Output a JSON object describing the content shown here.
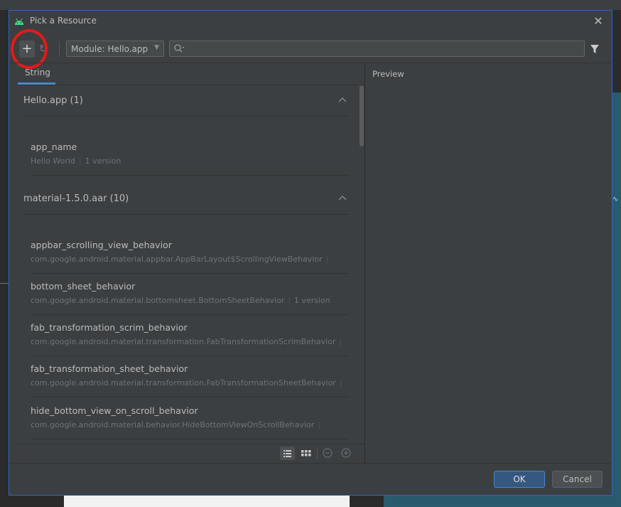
{
  "dialog": {
    "title": "Pick a Resource",
    "icon": "android-icon",
    "close_icon": "close-icon"
  },
  "toolbar": {
    "add_label": "+",
    "add_icon": "plus-icon",
    "refresh_icon": "refresh-icon",
    "module_select": "Module: Hello.app",
    "search_value": "",
    "search_icon": "search-icon",
    "filter_icon": "filter-icon"
  },
  "tabs": [
    {
      "label": "String",
      "selected": true
    }
  ],
  "groups": [
    {
      "title": "Hello.app (1)",
      "items": [
        {
          "name": "app_name",
          "value": "Hello World",
          "versions": "1 version"
        }
      ]
    },
    {
      "title": "material-1.5.0.aar (10)",
      "items": [
        {
          "name": "appbar_scrolling_view_behavior",
          "value": "com.google.android.material.appbar.AppBarLayout$ScrollingViewBehavior",
          "versions": ""
        },
        {
          "name": "bottom_sheet_behavior",
          "value": "com.google.android.material.bottomsheet.BottomSheetBehavior",
          "versions": "1 version"
        },
        {
          "name": "fab_transformation_scrim_behavior",
          "value": "com.google.android.material.transformation.FabTransformationScrimBehavior",
          "versions": ""
        },
        {
          "name": "fab_transformation_sheet_behavior",
          "value": "com.google.android.material.transformation.FabTransformationSheetBehavior",
          "versions": ""
        },
        {
          "name": "hide_bottom_view_on_scroll_behavior",
          "value": "com.google.android.material.behavior.HideBottomViewOnScrollBehavior",
          "versions": ""
        }
      ]
    }
  ],
  "preview": {
    "label": "Preview"
  },
  "footer": {
    "ok": "OK",
    "cancel": "Cancel"
  },
  "colors": {
    "accent": "#4a88c7",
    "highlight_circle": "#e31a1a",
    "dialog_bg": "#3c3f41"
  }
}
